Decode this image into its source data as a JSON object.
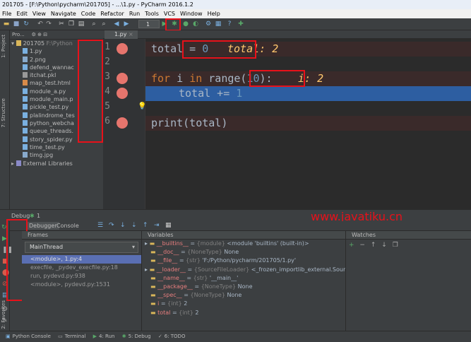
{
  "window": {
    "title": "201705 - [F:\\Python\\pycharm\\201705] - ...\\1.py - PyCharm 2016.1.2"
  },
  "menu": [
    "File",
    "Edit",
    "View",
    "Navigate",
    "Code",
    "Refactor",
    "Run",
    "Tools",
    "VCS",
    "Window",
    "Help"
  ],
  "toolbar": {
    "run_config": "1"
  },
  "left_tabs": {
    "project": "1: Project",
    "structure": "7: Structure",
    "favorites": "2: Favorites"
  },
  "project": {
    "header": "Pro...",
    "root": "201705",
    "root_path": "F:\\Python",
    "files": [
      "1.py",
      "2.png",
      "defend_wannac",
      "itchat.pkl",
      "map_test.html",
      "module_a.py",
      "module_main.p",
      "pickle_test.py",
      "plalindrome_tes",
      "python_webcha",
      "queue_threads.",
      "story_spider.py",
      "time_test.py",
      "timg.jpg"
    ],
    "external": "External Libraries"
  },
  "editor": {
    "tab": "1.py",
    "line_numbers": [
      "1",
      "2",
      "3",
      "4",
      "5",
      "6"
    ],
    "lines": {
      "l1_var": "total",
      "l1_eq": " = ",
      "l1_num": "0",
      "l3_for": "for",
      "l3_i": " i ",
      "l3_in": "in",
      "l3_range": " range(",
      "l3_num": "10",
      "l3_close": "):",
      "l4_body": "total += ",
      "l4_num": "1",
      "l6_print": "print(total)"
    },
    "inline": {
      "total": "total: 2",
      "i": "i: 2"
    }
  },
  "debug": {
    "title": "Debug",
    "config": "1",
    "debugger_tab": "Debugger",
    "console_tab": "Console",
    "frames_header": "Frames",
    "variables_header": "Variables",
    "watches_header": "Watches",
    "thread": "MainThread",
    "frames": [
      "<module>, 1.py:4",
      "execfile, _pydev_execfile.py:18",
      "run, pydevd.py:938",
      "<module>, pydevd.py:1531"
    ],
    "variables": [
      {
        "name": "__builtins__",
        "type": "{module}",
        "value": "<module 'builtins' (built-in)>"
      },
      {
        "name": "__doc__",
        "type": "{NoneType}",
        "value": "None"
      },
      {
        "name": "__file__",
        "type": "{str}",
        "value": "'F:/Python/pycharm/201705/1.py'"
      },
      {
        "name": "__loader__",
        "type": "{SourceFileLoader}",
        "value": "<_frozen_importlib_external.Sourc... View"
      },
      {
        "name": "__name__",
        "type": "{str}",
        "value": "'__main__'"
      },
      {
        "name": "__package__",
        "type": "{NoneType}",
        "value": "None"
      },
      {
        "name": "__spec__",
        "type": "{NoneType}",
        "value": "None"
      },
      {
        "name": "i",
        "type": "{int}",
        "value": "2"
      },
      {
        "name": "total",
        "type": "{int}",
        "value": "2"
      }
    ]
  },
  "watermark": "www.javatiku.cn",
  "status": {
    "python_console": "Python Console",
    "terminal": "Terminal",
    "run": "4: Run",
    "debug": "5: Debug",
    "todo": "6: TODO"
  },
  "colors": {
    "breakpoint": "#e6756d",
    "highlight": "#2d5ea1",
    "annotation": "#e8111a",
    "keyword": "#cc7832",
    "number": "#6897bb"
  }
}
